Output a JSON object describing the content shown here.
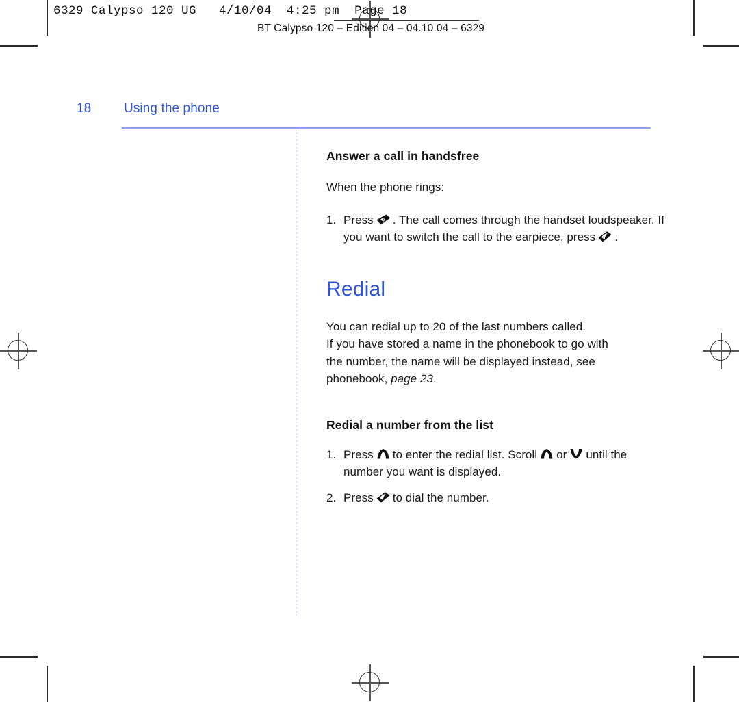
{
  "print_stamp": {
    "line": "6329 Calypso 120 UG   4/10/04  4:25 pm  Page 18",
    "edition": "BT Calypso 120 – Edition 04 – 04.10.04 – 6329"
  },
  "running_head": {
    "page_number": "18",
    "section_title": "Using the phone"
  },
  "colors": {
    "accent_blue": "#2f54dd",
    "rule_blue": "#8f9ff0",
    "dotted_blue": "#aab6f2",
    "body_text": "#1a1a1a"
  },
  "sections": {
    "handsfree": {
      "heading": "Answer a call in handsfree",
      "intro": "When the phone rings:",
      "steps": [
        {
          "number": "1.",
          "text_before_icon": "Press",
          "icon": "loudspeaker-key-icon",
          "text_after_icon": ". The call comes through the handset loudspeaker. If you want to switch the call to the earpiece, press",
          "icon2": "handset-key-icon",
          "text_end": "."
        }
      ]
    },
    "redial": {
      "title": "Redial",
      "body_line_1": "You can redial up to 20 of the last numbers called.",
      "body_line_2": "If you have stored a name in the phonebook to go with",
      "body_line_3": "the number, the name will be displayed instead, see",
      "body_line_4_prefix": "phonebook,",
      "body_line_4_pageref": "page 23",
      "body_line_4_suffix": "."
    },
    "redial_list": {
      "heading": "Redial a number from the list",
      "steps": [
        {
          "number": "1.",
          "part_a": "Press",
          "icon_a": "scroll-up-key-icon",
          "part_b": "to enter the redial list. Scroll",
          "icon_b": "scroll-up-key-icon",
          "part_c": "or",
          "icon_c": "scroll-down-key-icon",
          "part_d": "until the number you want is displayed."
        },
        {
          "number": "2.",
          "part_a": "Press",
          "icon_a": "handset-key-icon",
          "part_b": "to dial the number."
        }
      ]
    }
  }
}
